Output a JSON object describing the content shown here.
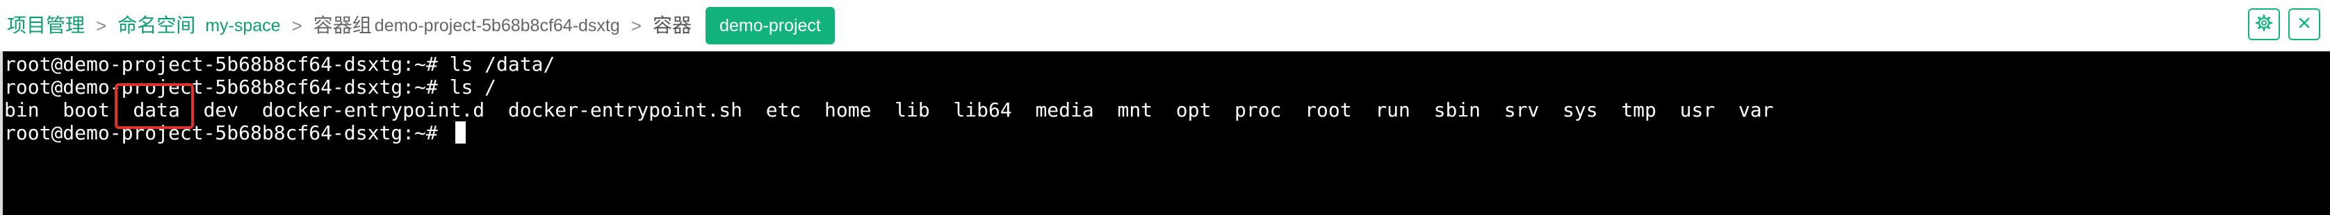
{
  "breadcrumb": {
    "project_mgmt": "项目管理",
    "sep": ">",
    "namespace_label": "命名空间",
    "namespace_value": "my-space",
    "container_group_label": "容器组",
    "container_group_value": "demo-project-5b68b8cf64-dsxtg",
    "container_label": "容器",
    "container_tag": "demo-project"
  },
  "header_actions": [
    {
      "name": "settings",
      "icon": "gear-icon"
    },
    {
      "name": "close",
      "icon": "close-icon"
    }
  ],
  "terminal": {
    "lines": [
      "root@demo-project-5b68b8cf64-dsxtg:~# ls /data/",
      "root@demo-project-5b68b8cf64-dsxtg:~# ls /",
      "bin  boot  data  dev  docker-entrypoint.d  docker-entrypoint.sh  etc  home  lib  lib64  media  mnt  opt  proc  root  run  sbin  srv  sys  tmp  usr  var",
      "root@demo-project-5b68b8cf64-dsxtg:~# "
    ],
    "highlight_word": "data"
  },
  "colors": {
    "accent": "#13b27d",
    "link": "#0e9e6e",
    "highlight_box": "#e0322b",
    "terminal_bg": "#000000",
    "terminal_fg": "#ffffff"
  }
}
